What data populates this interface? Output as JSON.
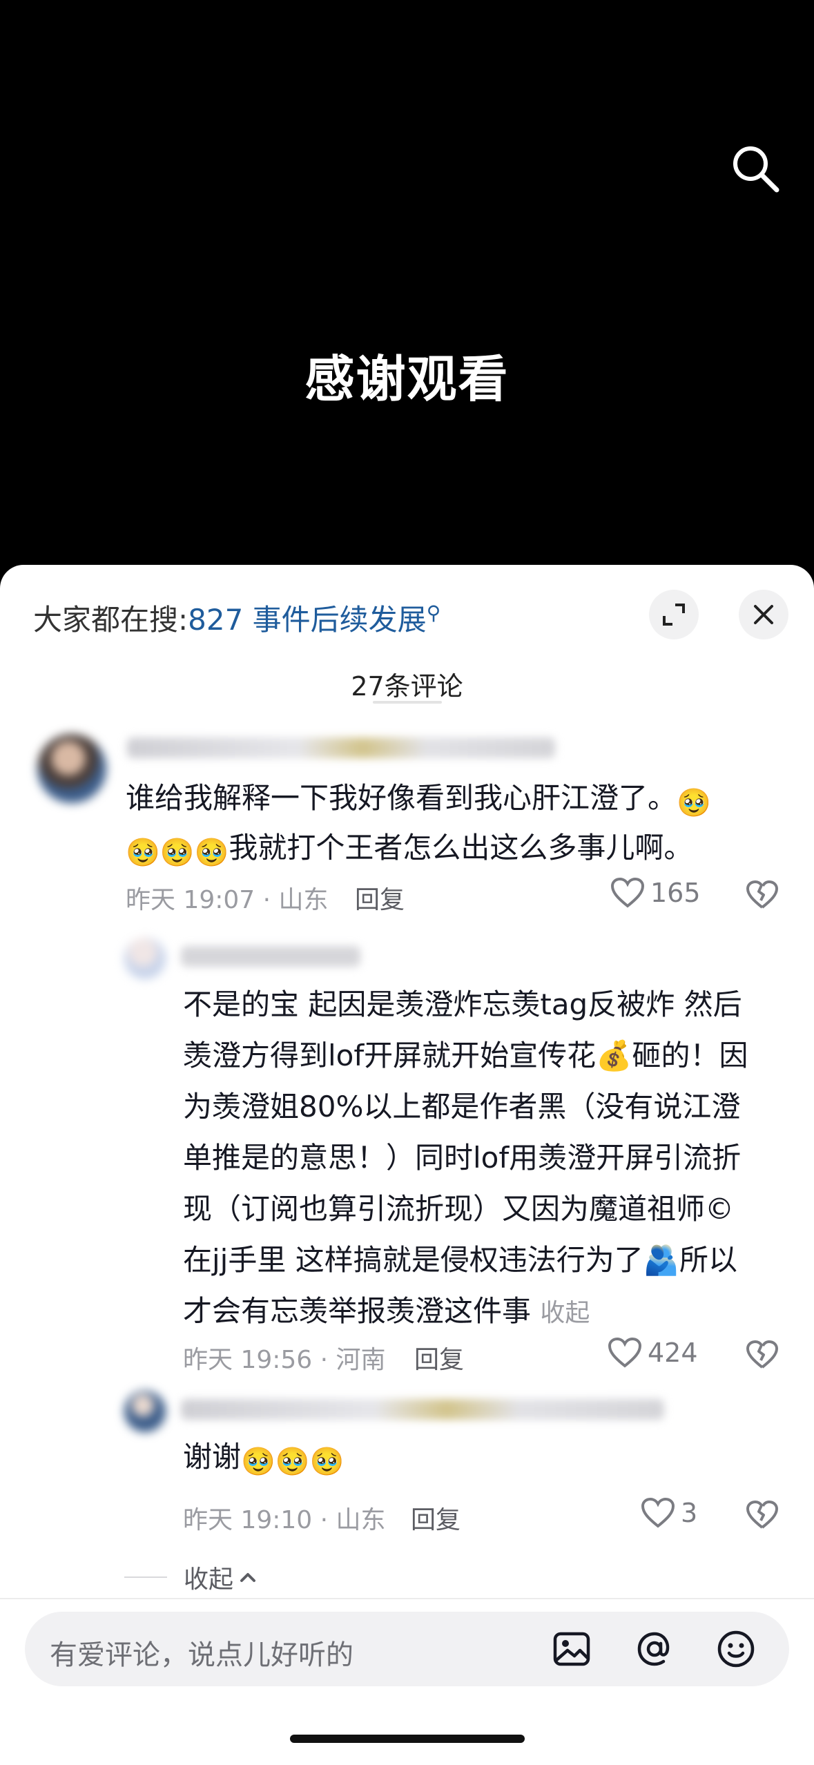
{
  "video": {
    "title": "感谢观看",
    "search_icon": "search-icon"
  },
  "sheet": {
    "hot_search_prefix": "大家都在搜:",
    "hot_search_link": "827 事件后续发展",
    "comment_count": "27条评论",
    "expand_icon": "expand-icon",
    "close_icon": "close-icon"
  },
  "comments": [
    {
      "text_line1": "谁给我解释一下我好像看到我心肝江澄了。",
      "emoji_after_line1": "🥹",
      "emojis_line2": "🥹🥹🥹",
      "text_line2": "我就打个王者怎么出这么多事儿啊。",
      "meta": "昨天 19:07 · 山东",
      "reply_label": "回复",
      "likes": "165"
    },
    {
      "lines": [
        "不是的宝 起因是羡澄炸忘羡tag反被炸 然后",
        "羡澄方得到lof开屏就开始宣传花💰砸的！因",
        "为羡澄姐80%以上都是作者黑（没有说江澄",
        "单推是的意思！）同时lof用羡澄开屏引流折",
        "现（订阅也算引流折现）又因为魔道祖师©",
        "在jj手里 这样搞就是侵权违法行为了🫂所以",
        "才会有忘羡举报羡澄这件事"
      ],
      "collapse_inline": "收起",
      "meta": "昨天 19:56 · 河南",
      "reply_label": "回复",
      "likes": "424"
    },
    {
      "text": "谢谢",
      "emojis": "🥹🥹🥹",
      "meta": "昨天 19:10 · 山东",
      "reply_label": "回复",
      "likes": "3"
    }
  ],
  "collapse_label": "收起",
  "input": {
    "placeholder": "有爱评论，说点儿好听的",
    "image_icon": "image-icon",
    "at_icon": "at-icon",
    "emoji_icon": "emoji-icon"
  }
}
